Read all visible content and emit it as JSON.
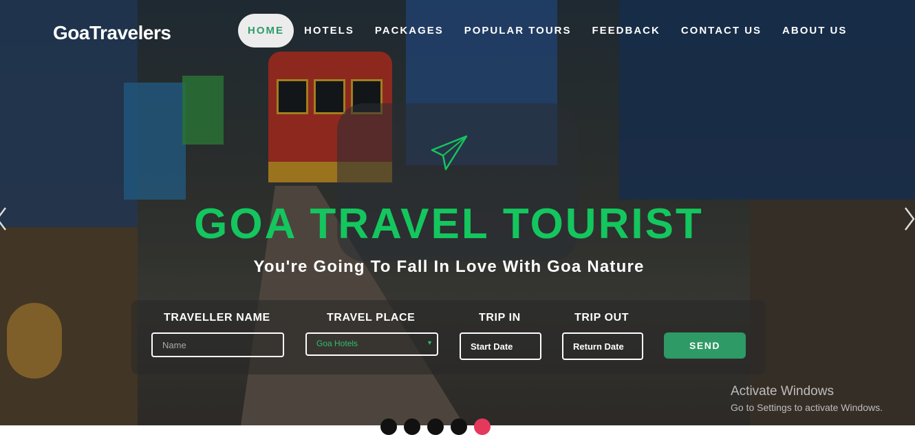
{
  "brand": "GoaTravelers",
  "nav": {
    "items": [
      {
        "label": "HOME",
        "active": true
      },
      {
        "label": "HOTELS"
      },
      {
        "label": "PACKAGES"
      },
      {
        "label": "POPULAR TOURS"
      },
      {
        "label": "FEEDBACK"
      },
      {
        "label": "CONTACT US"
      },
      {
        "label": "ABOUT US"
      }
    ]
  },
  "hero": {
    "headline": "GOA TRAVEL TOURIST",
    "subheadline": "You're Going To Fall In Love With Goa Nature",
    "prev_icon": "chevron-left-icon",
    "next_icon": "chevron-right-icon",
    "decor_icon": "paper-plane-icon"
  },
  "booking": {
    "traveller_label": "TRAVELLER NAME",
    "traveller_placeholder": "Name",
    "place_label": "TRAVEL PLACE",
    "place_selected": "Goa Hotels",
    "trip_in_label": "TRIP IN",
    "trip_in_value": "Start Date",
    "trip_out_label": "TRIP OUT",
    "trip_out_value": "Return Date",
    "send_label": "SEND"
  },
  "watermark": {
    "title": "Activate Windows",
    "subtitle": "Go to Settings to activate Windows."
  },
  "colors": {
    "accent": "#14c65e",
    "button": "#2e9a66",
    "nav_active_text": "#2d9b6a"
  }
}
